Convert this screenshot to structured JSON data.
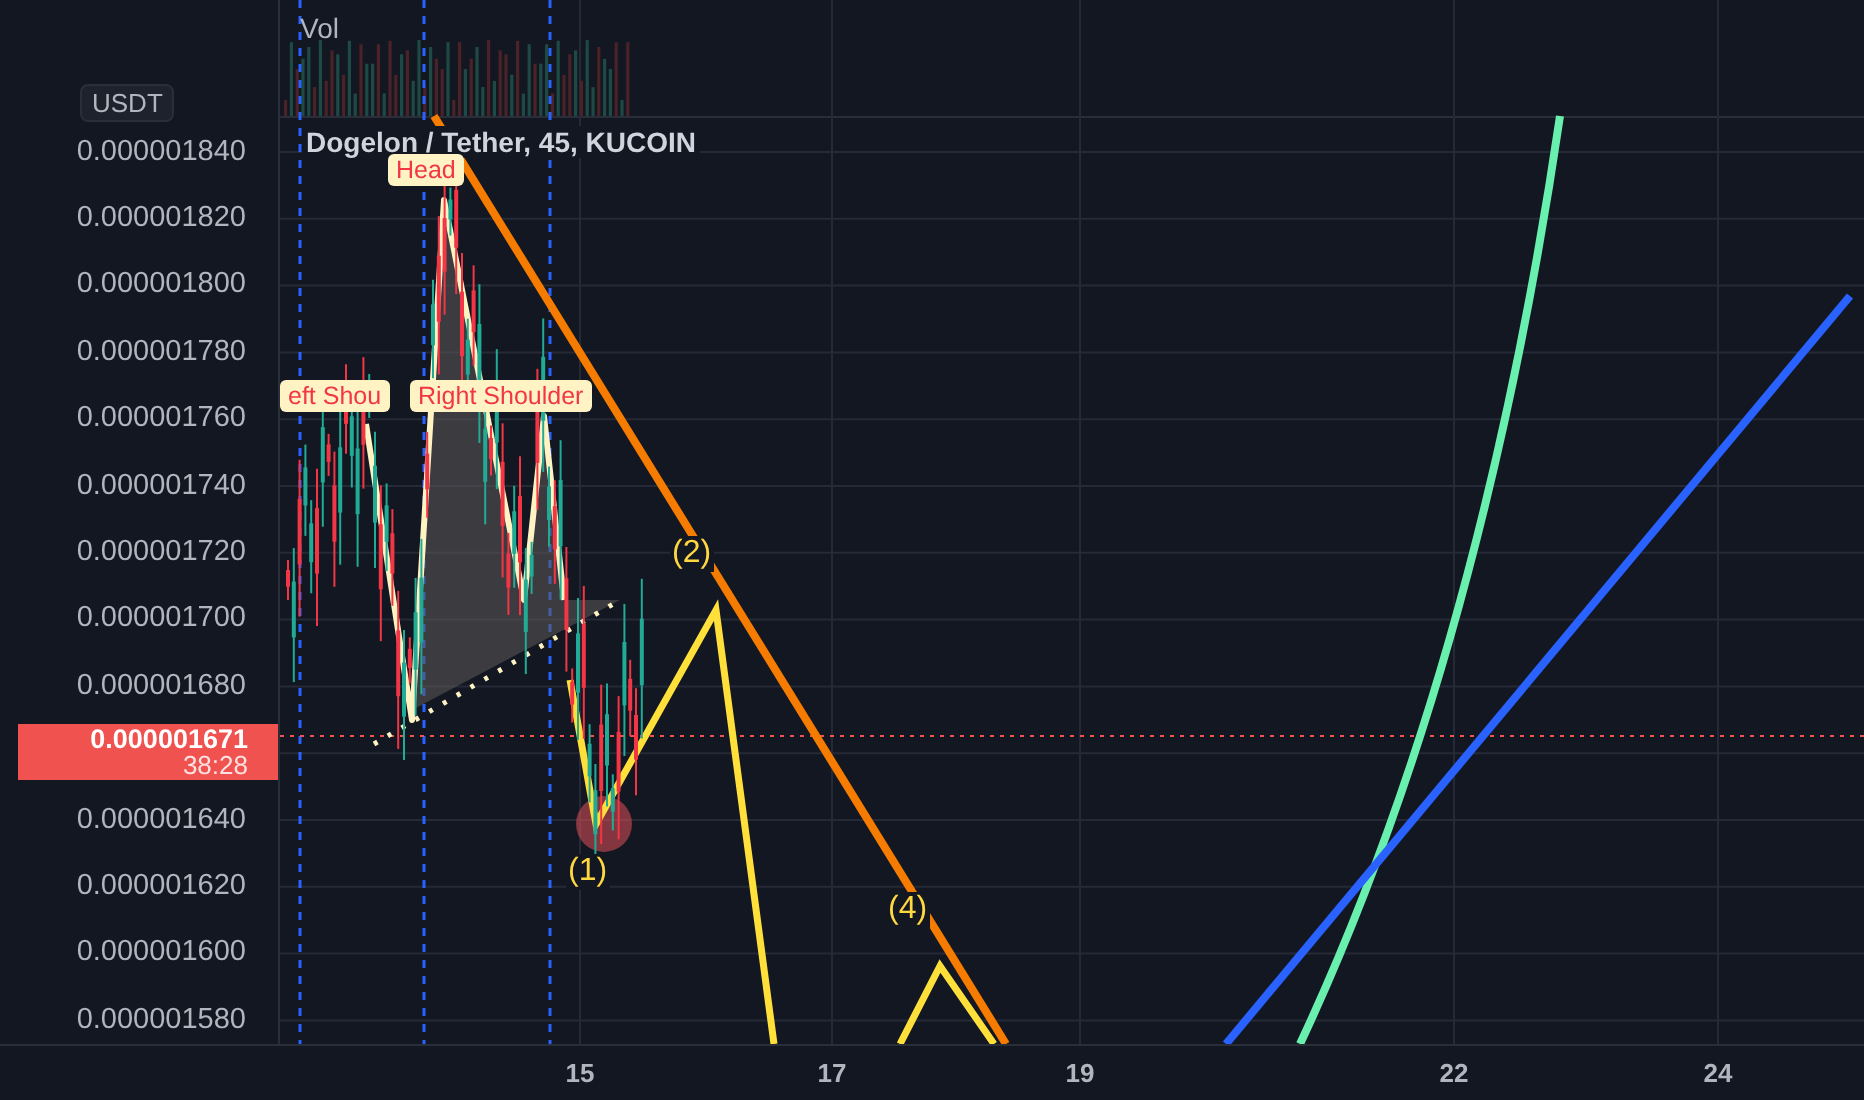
{
  "volume_pane": {
    "label": "Vol"
  },
  "price_axis": {
    "currency_badge": "USDT",
    "labels": [
      "0.000001840",
      "0.000001820",
      "0.000001800",
      "0.000001780",
      "0.000001760",
      "0.000001740",
      "0.000001720",
      "0.000001700",
      "0.000001680",
      "0.000001640",
      "0.000001620",
      "0.000001600",
      "0.000001580"
    ],
    "last_price": {
      "price": "0.000001671",
      "countdown": "38:28"
    }
  },
  "chart": {
    "title": "Dogelon / Tether, 45, KUCOIN",
    "pattern_labels": [
      {
        "text": "Head"
      },
      {
        "text": "eft Shou"
      },
      {
        "text": "Right Shoulder"
      }
    ],
    "wave_labels": [
      "(1)",
      "(2)",
      "(4)"
    ]
  },
  "time_axis": {
    "labels": [
      "15",
      "17",
      "19",
      "22",
      "24"
    ]
  }
}
